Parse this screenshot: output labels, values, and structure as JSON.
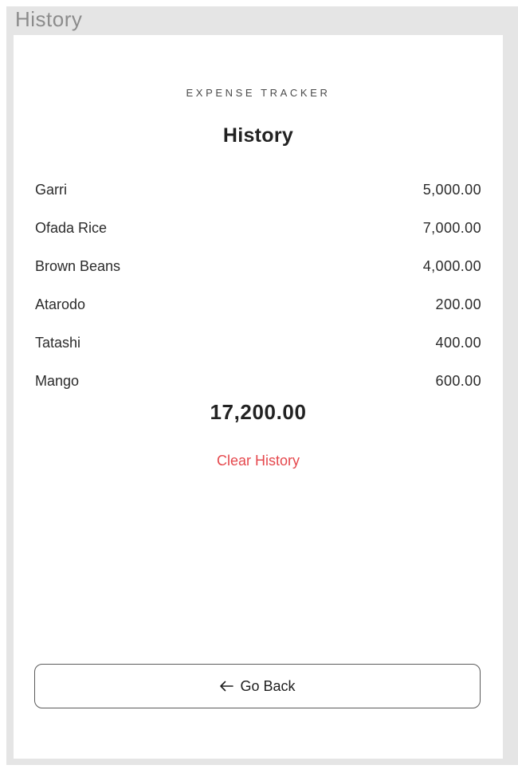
{
  "frame": {
    "title": "History"
  },
  "app": {
    "name": "EXPENSE TRACKER"
  },
  "page": {
    "heading": "History"
  },
  "history": {
    "items": [
      {
        "name": "Garri",
        "amount": "5,000.00"
      },
      {
        "name": "Ofada Rice",
        "amount": "7,000.00"
      },
      {
        "name": "Brown Beans",
        "amount": "4,000.00"
      },
      {
        "name": "Atarodo",
        "amount": "200.00"
      },
      {
        "name": "Tatashi",
        "amount": "400.00"
      },
      {
        "name": "Mango",
        "amount": "600.00"
      }
    ],
    "total": "17,200.00",
    "clear_label": "Clear History"
  },
  "footer": {
    "back_label": "Go Back",
    "back_icon": "arrow-left-icon"
  },
  "colors": {
    "danger": "#e5484d",
    "frame_background": "#e5e5e5",
    "screen_background": "#ffffff"
  }
}
